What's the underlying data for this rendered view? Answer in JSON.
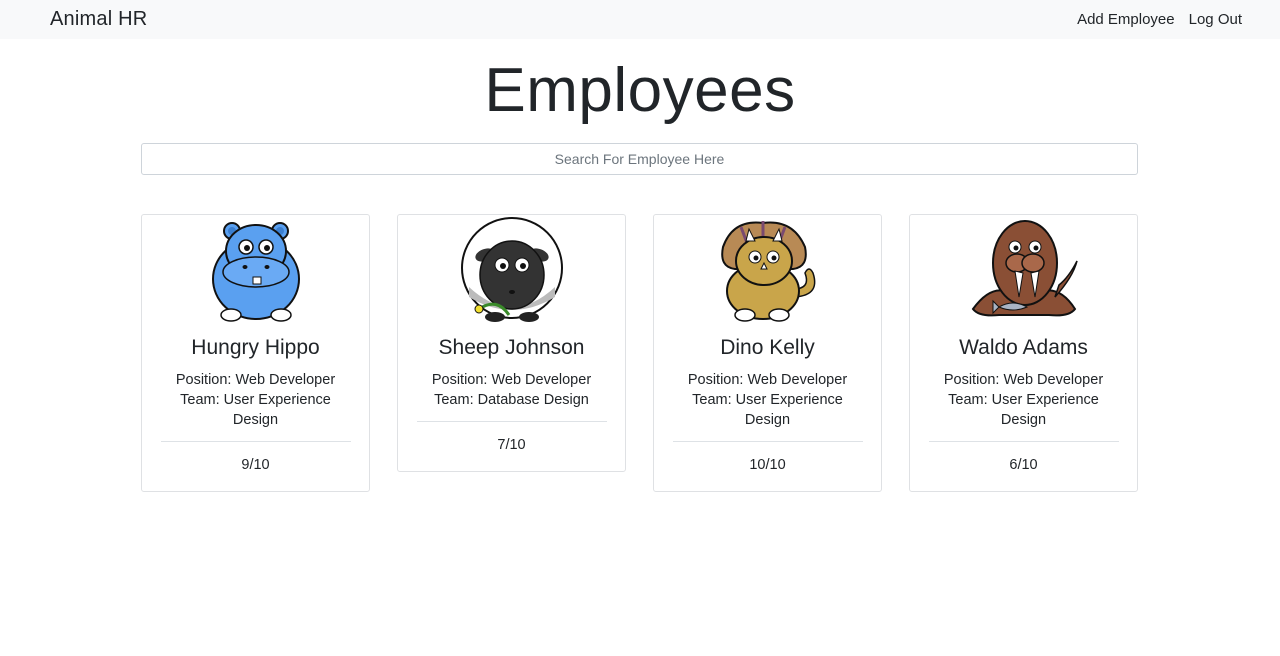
{
  "navbar": {
    "brand": "Animal HR",
    "links": [
      "Add Employee",
      "Log Out"
    ]
  },
  "page": {
    "title": "Employees",
    "search_placeholder": "Search For Employee Here"
  },
  "employees": [
    {
      "name": "Hungry Hippo",
      "position": "Position: Web Developer",
      "team": "Team: User Experience Design",
      "rating": "9/10",
      "icon": "hippo-icon"
    },
    {
      "name": "Sheep Johnson",
      "position": "Position: Web Developer",
      "team": "Team: Database Design",
      "rating": "7/10",
      "icon": "sheep-icon"
    },
    {
      "name": "Dino Kelly",
      "position": "Position: Web Developer",
      "team": "Team: User Experience Design",
      "rating": "10/10",
      "icon": "triceratops-icon"
    },
    {
      "name": "Waldo Adams",
      "position": "Position: Web Developer",
      "team": "Team: User Experience Design",
      "rating": "6/10",
      "icon": "walrus-icon"
    }
  ],
  "colors": {
    "navbar_bg": "#f8f9fa",
    "text": "#212529",
    "card_border": "#dfe1e4",
    "hippo": "#5aa0f0",
    "sheep": "#333333",
    "dino": "#c9a54a",
    "walrus": "#8a4f35"
  }
}
